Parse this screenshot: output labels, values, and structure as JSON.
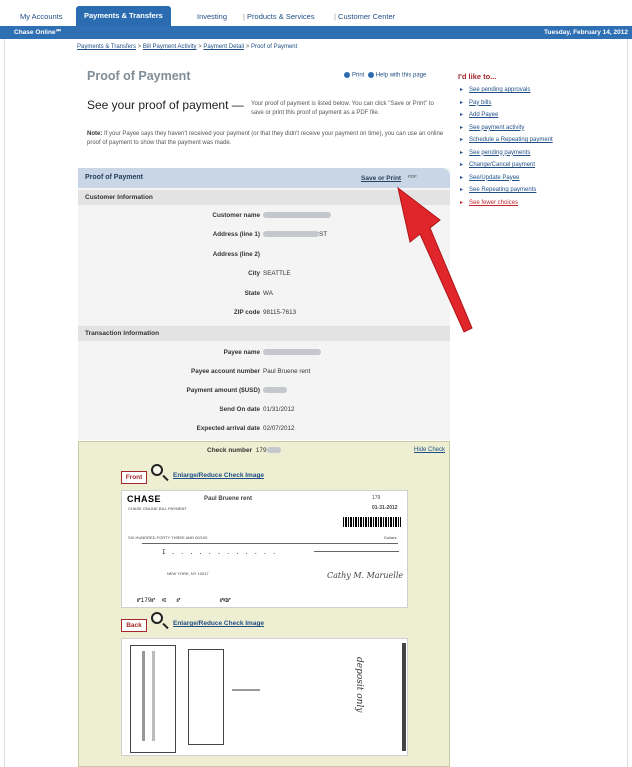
{
  "topnav": {
    "tabs": [
      "My Accounts",
      "Payments & Transfers",
      "Investing",
      "Products & Services",
      "Customer Center"
    ],
    "active_index": 1
  },
  "bluebar": {
    "brand": "Chase Online℠",
    "date": "Tuesday, February 14, 2012"
  },
  "breadcrumb": {
    "items": [
      "Payments & Transfers",
      "Bill Payment Activity",
      "Payment Detail",
      "Proof of Payment"
    ],
    "separator": " > "
  },
  "page": {
    "title": "Proof of Payment",
    "print_label": "Print",
    "help_label": "Help with this page",
    "heading": "See your proof of payment —",
    "intro": "Your proof of payment is listed below. You can click \"Save or Print\" to save or print this proof of payment as a PDF file.",
    "note_label": "Note:",
    "note": "If your Payee says they haven't received your payment (or that they didn't receive your payment on time), you can use an online proof of payment to show that the payment was made."
  },
  "menu": {
    "title": "I'd like to...",
    "items": [
      {
        "label": "See pending approvals"
      },
      {
        "label": "Pay bills"
      },
      {
        "label": "Add Payee"
      },
      {
        "label": "See payment activity"
      },
      {
        "label": "Schedule a Repeating payment"
      },
      {
        "label": "See pending payments"
      },
      {
        "label": "Change/Cancel payment"
      },
      {
        "label": "See/Update Payee"
      },
      {
        "label": "See Repeating payments"
      },
      {
        "label": "See fewer choices"
      }
    ]
  },
  "panel": {
    "title": "Proof of Payment",
    "save_label": "Save or Print",
    "pdf_label": "PDF",
    "customer_section": "Customer Information",
    "customer": {
      "name_label": "Customer name",
      "address1_label": "Address (line 1)",
      "address1_suffix": "ST",
      "address2_label": "Address (line 2)",
      "city_label": "City",
      "city": "SEATTLE",
      "state_label": "State",
      "state": "WA",
      "zip_label": "ZIP code",
      "zip": "98115-7613"
    },
    "transaction_section": "Transaction Information",
    "transaction": {
      "payee_label": "Payee name",
      "account_label": "Payee account number",
      "account": "Paul Bruene rent",
      "amount_label": "Payment amount ($USD)",
      "send_label": "Send On date",
      "send": "01/31/2012",
      "arrival_label": "Expected arrival date",
      "arrival": "02/07/2012"
    }
  },
  "check": {
    "number_label": "Check number",
    "number": "179",
    "hide_label": "Hide Check",
    "front_label": "Front",
    "back_label": "Back",
    "enlarge_label": "Enlarge/Reduce Check Image",
    "front": {
      "bank": "CHASE",
      "payee": "Paul Bruene rent",
      "check_no": "179",
      "date": "01-31-2012",
      "amount_words": "SIX HUNDRED FORTY THREE AND 00/100",
      "city": "NEW YORK, NY 10017",
      "dollars": "Dollars"
    },
    "back": {
      "endorse": "deposit only"
    }
  }
}
